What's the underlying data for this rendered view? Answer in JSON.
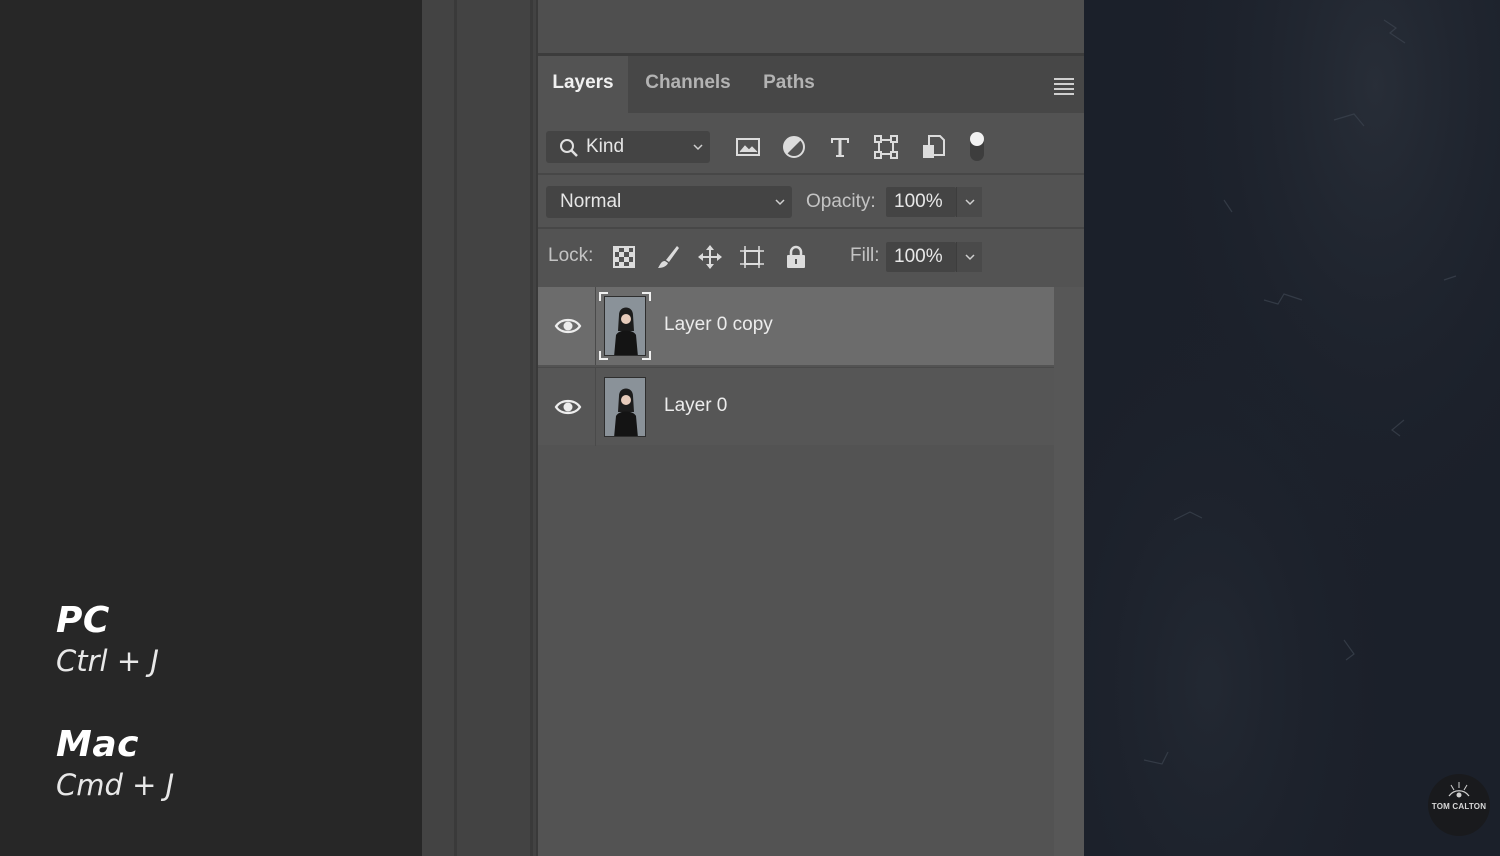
{
  "shortcuts": {
    "pc": {
      "os": "PC",
      "keys": "Ctrl + J"
    },
    "mac": {
      "os": "Mac",
      "keys": "Cmd + J"
    }
  },
  "panel": {
    "tabs": [
      {
        "label": "Layers",
        "active": true
      },
      {
        "label": "Channels",
        "active": false
      },
      {
        "label": "Paths",
        "active": false
      }
    ],
    "menu_icon": "hamburger-menu-icon",
    "filter": {
      "kind_label": "Kind",
      "icons": [
        "pixel-layer-filter-icon",
        "adjustment-layer-filter-icon",
        "type-layer-filter-icon",
        "shape-layer-filter-icon",
        "smart-object-filter-icon",
        "filter-toggle-icon"
      ]
    },
    "blend": {
      "mode": "Normal",
      "opacity_label": "Opacity:",
      "opacity_value": "100%"
    },
    "lock": {
      "label": "Lock:",
      "icons": [
        "lock-transparent-pixels-icon",
        "lock-image-pixels-icon",
        "lock-position-icon",
        "lock-artboard-icon",
        "lock-all-icon"
      ],
      "fill_label": "Fill:",
      "fill_value": "100%"
    },
    "layers": [
      {
        "name": "Layer 0 copy",
        "visible": true,
        "selected": true
      },
      {
        "name": "Layer 0",
        "visible": true,
        "selected": false
      }
    ]
  },
  "colors": {
    "panel_bg": "#535353",
    "selected_row": "#6c6c6c",
    "canvas_bg": "#1b202a"
  },
  "watermark": {
    "text": "TOM CALTON"
  }
}
